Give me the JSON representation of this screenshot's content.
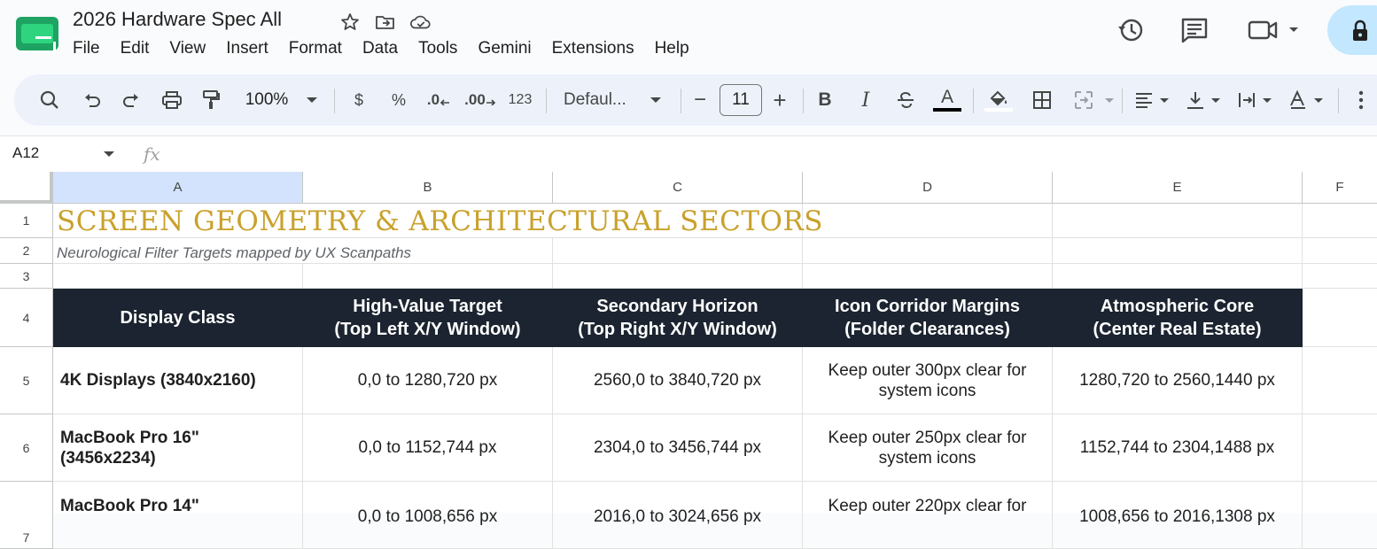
{
  "app": {
    "doc_title": "2026 Hardware Spec All",
    "menu": [
      "File",
      "Edit",
      "View",
      "Insert",
      "Format",
      "Data",
      "Tools",
      "Gemini",
      "Extensions",
      "Help"
    ]
  },
  "toolbar": {
    "zoom": "100%",
    "currency": "$",
    "percent": "%",
    "dec_decrease": ".0",
    "dec_increase": ".00",
    "number_format": "123",
    "font": "Defaul...",
    "minus": "−",
    "font_size": "11",
    "plus": "+",
    "bold": "B",
    "italic": "I",
    "text_color": "A",
    "text_color_hex": "#000000"
  },
  "formula_bar": {
    "name_box": "A12",
    "fx": "fx"
  },
  "columns": [
    "A",
    "B",
    "C",
    "D",
    "E",
    "F"
  ],
  "rows": [
    "1",
    "2",
    "3",
    "4",
    "5",
    "6",
    "7"
  ],
  "sheet": {
    "title": "Screen Geometry & Architectural Sectors",
    "subtitle": "Neurological Filter Targets mapped by UX Scanpaths",
    "headers": [
      {
        "line1": "Display Class",
        "line2": ""
      },
      {
        "line1": "High-Value Target",
        "line2": "(Top Left X/Y Window)"
      },
      {
        "line1": "Secondary Horizon",
        "line2": "(Top Right X/Y Window)"
      },
      {
        "line1": "Icon Corridor Margins",
        "line2": "(Folder Clearances)"
      },
      {
        "line1": "Atmospheric Core",
        "line2": "(Center Real Estate)"
      }
    ],
    "data_rows": [
      [
        "4K Displays (3840x2160)",
        "0,0 to 1280,720 px",
        "2560,0 to 3840,720 px",
        "Keep outer 300px clear for system icons",
        "1280,720 to 2560,1440 px"
      ],
      [
        "MacBook Pro 16\" (3456x2234)",
        "0,0 to 1152,744 px",
        "2304,0 to 3456,744 px",
        "Keep outer 250px clear for system icons",
        "1152,744 to 2304,1488 px"
      ],
      [
        "MacBook Pro 14\"",
        "0,0 to 1008,656 px",
        "2016,0 to 3024,656 px",
        "Keep outer 220px clear for",
        "1008,656 to 2016,1308 px"
      ]
    ]
  },
  "colors": {
    "header_bg": "#1b2430",
    "title_gold": "#c9a12c",
    "accent": "#c2e7ff"
  }
}
